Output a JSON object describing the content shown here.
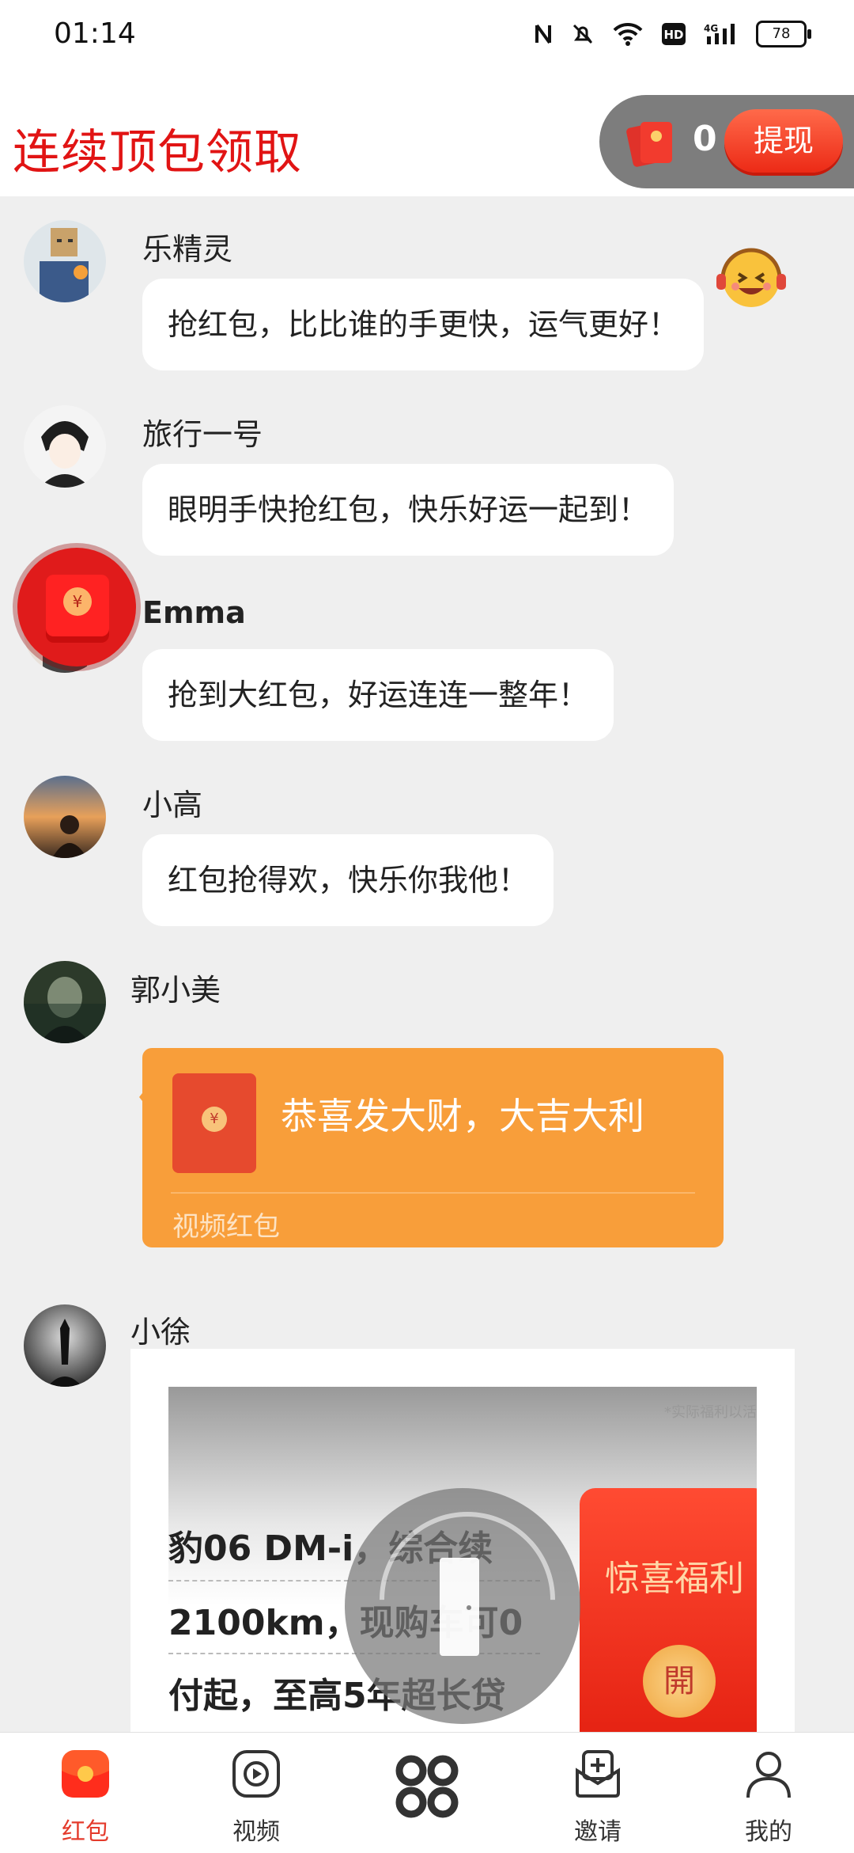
{
  "status_bar": {
    "time": "01:14",
    "battery": "78"
  },
  "header": {
    "title": "连续顶包领取",
    "wallet_count": "0",
    "withdraw_label": "提现"
  },
  "messages": [
    {
      "sender": "乐精灵",
      "text": "抢红包，比比谁的手更快，运气更好！"
    },
    {
      "sender": "旅行一号",
      "text": "眼明手快抢红包，快乐好运一起到！"
    },
    {
      "sender": "Emma",
      "text": "抢到大红包，好运连连一整年！"
    },
    {
      "sender": "小高",
      "text": "红包抢得欢，快乐你我他！"
    },
    {
      "sender": "郭小美",
      "red_packet": {
        "title": "恭喜发大财，大吉大利",
        "label": "视频红包",
        "coin": "¥"
      }
    },
    {
      "sender": "小徐",
      "ad": {
        "disclaimer": "*实际福利以活",
        "lines": [
          "豹06 DM-i，综合续",
          "2100km，现购车可0",
          "付起，至高5年超长贷"
        ],
        "promo_text": "惊喜福利",
        "open_label": "開"
      }
    }
  ],
  "tabs": [
    {
      "label": "红包",
      "icon": "red-packet-icon",
      "active": true
    },
    {
      "label": "视频",
      "icon": "video-icon",
      "active": false
    },
    {
      "label": "",
      "icon": "grid-icon",
      "active": false
    },
    {
      "label": "邀请",
      "icon": "invite-icon",
      "active": false
    },
    {
      "label": "我的",
      "icon": "profile-icon",
      "active": false
    }
  ],
  "colors": {
    "accent": "#e11414",
    "red_packet": "#f89e3a",
    "tab_active": "#e43b2c"
  }
}
